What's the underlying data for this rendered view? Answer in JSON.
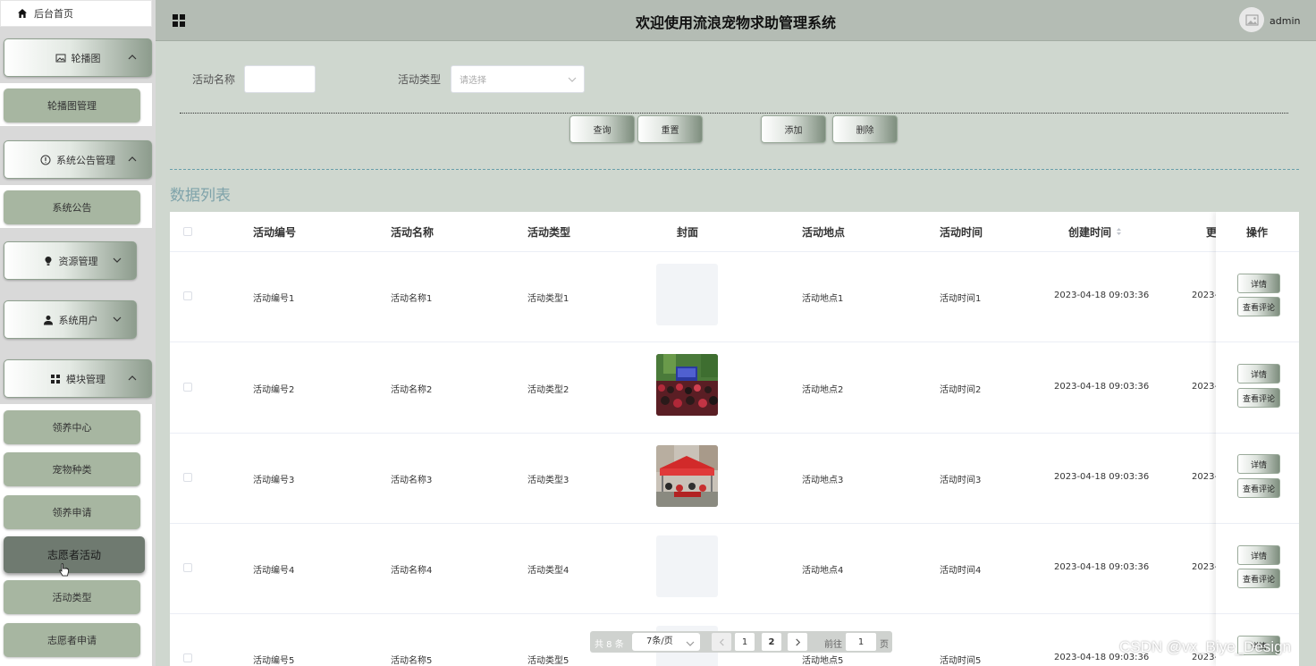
{
  "sidebar": {
    "home": "后台首页",
    "menus": [
      {
        "label": "轮播图",
        "icon": "image-icon",
        "items": [
          "轮播图管理"
        ]
      },
      {
        "label": "系统公告管理",
        "icon": "info-circle-icon",
        "items": [
          "系统公告"
        ]
      },
      {
        "label": "资源管理",
        "icon": "bulb-icon",
        "items": []
      },
      {
        "label": "系统用户",
        "icon": "user-icon",
        "items": []
      },
      {
        "label": "模块管理",
        "icon": "grid-icon",
        "items": [
          "领养中心",
          "宠物种类",
          "领养申请",
          "志愿者活动",
          "活动类型",
          "志愿者申请"
        ]
      }
    ],
    "active_item": "志愿者活动"
  },
  "header": {
    "title": "欢迎使用流浪宠物求助管理系统",
    "user": "admin"
  },
  "search": {
    "name_label": "活动名称",
    "name_value": "",
    "type_label": "活动类型",
    "type_placeholder": "请选择",
    "buttons": {
      "query": "查询",
      "reset": "重置",
      "add": "添加",
      "delete": "删除"
    }
  },
  "section_title": "数据列表",
  "table": {
    "columns": [
      "活动编号",
      "活动名称",
      "活动类型",
      "封面",
      "活动地点",
      "活动时间",
      "创建时间",
      "更",
      "操作"
    ],
    "rows": [
      {
        "code": "活动编号1",
        "name": "活动名称1",
        "type": "活动类型1",
        "cover": "placeholder",
        "place": "活动地点1",
        "time": "活动时间1",
        "created": "2023-04-18 09:03:36",
        "updated": "2023-"
      },
      {
        "code": "活动编号2",
        "name": "活动名称2",
        "type": "活动类型2",
        "cover": "photo-crowd",
        "place": "活动地点2",
        "time": "活动时间2",
        "created": "2023-04-18 09:03:36",
        "updated": "2023-"
      },
      {
        "code": "活动编号3",
        "name": "活动名称3",
        "type": "活动类型3",
        "cover": "photo-tent",
        "place": "活动地点3",
        "time": "活动时间3",
        "created": "2023-04-18 09:03:36",
        "updated": "2023-"
      },
      {
        "code": "活动编号4",
        "name": "活动名称4",
        "type": "活动类型4",
        "cover": "placeholder",
        "place": "活动地点4",
        "time": "活动时间4",
        "created": "2023-04-18 09:03:36",
        "updated": "2023-"
      },
      {
        "code": "活动编号5",
        "name": "活动名称5",
        "type": "活动类型5",
        "cover": "placeholder",
        "place": "活动地点5",
        "time": "活动时间5",
        "created": "2023-04-18 09:03:36",
        "updated": "2023-"
      }
    ],
    "op_detail": "详情",
    "op_comments": "查看评论"
  },
  "pagination": {
    "total": "共 8 条",
    "page_size": "7条/页",
    "pages": [
      "1",
      "2"
    ],
    "current_page": "2",
    "goto_label": "前往",
    "goto_value": "1",
    "page_suffix": "页"
  },
  "watermark": "CSDN @vx_Biye_Design",
  "colors": {
    "sidebar_sub": "#a7b6a1",
    "active": "#6f7a70",
    "header": "#b4bcb4",
    "content_bg": "#cfd7cf",
    "section_title": "#7fa3aa"
  }
}
